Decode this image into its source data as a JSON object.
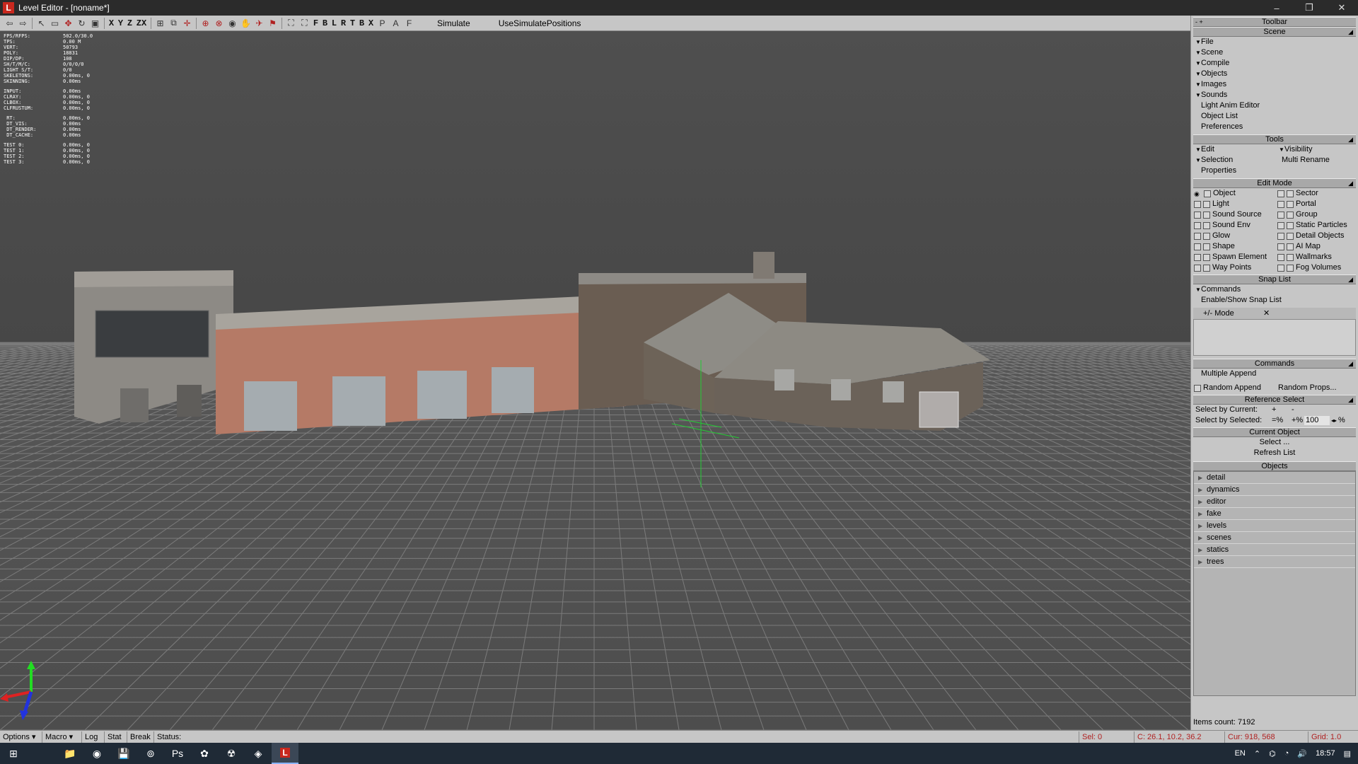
{
  "window": {
    "title": "Level Editor - [noname*]",
    "app_icon": "L",
    "min": "–",
    "max": "❐",
    "close": "✕"
  },
  "toolbar": {
    "axis_letters": [
      "X",
      "Y",
      "Z",
      "ZX"
    ],
    "letters": [
      "F",
      "B",
      "L",
      "R",
      "T",
      "B",
      "X"
    ],
    "simulate": "Simulate",
    "use_simulate_positions": "UseSimulatePositions"
  },
  "stats": [
    [
      "FPS/RFPS:",
      "502.0/30.0"
    ],
    [
      "TPS:",
      "0.00 M"
    ],
    [
      "VERT:",
      "50793"
    ],
    [
      "POLY:",
      "18831"
    ],
    [
      "DIP/DP:",
      "108"
    ],
    [
      "SH/T/M/C:",
      "0/0/0/0"
    ],
    [
      "LIGHT S/T:",
      "0/0"
    ],
    [
      "SKELETONS:",
      "0.00ms, 0"
    ],
    [
      "SKINNING:",
      "0.00ms"
    ],
    [
      "",
      ""
    ],
    [
      "INPUT:",
      "0.00ms"
    ],
    [
      "CLRAY:",
      "0.00ms, 0"
    ],
    [
      "CLBOX:",
      "0.00ms, 0"
    ],
    [
      "CLFRUSTUM:",
      "0.00ms, 0"
    ],
    [
      "",
      ""
    ],
    [
      " RT:",
      "0.00ms, 0"
    ],
    [
      " DT_VIS:",
      "0.00ms"
    ],
    [
      " DT_RENDER:",
      "0.00ms"
    ],
    [
      " DT_CACHE:",
      "0.00ms"
    ],
    [
      "",
      ""
    ],
    [
      "TEST 0:",
      "0.00ms, 0"
    ],
    [
      "TEST 1:",
      "0.00ms, 0"
    ],
    [
      "TEST 2:",
      "0.00ms, 0"
    ],
    [
      "TEST 3:",
      "0.00ms, 0"
    ]
  ],
  "panel": {
    "toolbar_header": "Toolbar",
    "toolbar_pin": "- +",
    "scene_header": "Scene",
    "scene_items": [
      {
        "label": "File",
        "arrow": true
      },
      {
        "label": "Scene",
        "arrow": true
      },
      {
        "label": "Compile",
        "arrow": true
      },
      {
        "label": "Objects",
        "arrow": true
      },
      {
        "label": "Images",
        "arrow": true
      },
      {
        "label": "Sounds",
        "arrow": true
      },
      {
        "label": "Light Anim Editor",
        "arrow": false
      },
      {
        "label": "Object List",
        "arrow": false
      },
      {
        "label": "Preferences",
        "arrow": false
      }
    ],
    "tools_header": "Tools",
    "tools": {
      "edit": "Edit",
      "visibility": "Visibility",
      "selection": "Selection",
      "multi_rename": "Multi Rename",
      "properties": "Properties"
    },
    "edit_mode_header": "Edit Mode",
    "edit_mode_left": [
      "Object",
      "Light",
      "Sound Source",
      "Sound Env",
      "Glow",
      "Shape",
      "Spawn Element",
      "Way Points"
    ],
    "edit_mode_right": [
      "Sector",
      "Portal",
      "Group",
      "Static Particles",
      "Detail Objects",
      "AI Map",
      "Wallmarks",
      "Fog Volumes"
    ],
    "snap_header": "Snap List",
    "snap_commands": "Commands",
    "snap_enable": "Enable/Show Snap List",
    "mode_label": "+/- Mode",
    "mode_close": "✕",
    "commands_header": "Commands",
    "multiple_append": "Multiple Append",
    "random_append": "Random Append",
    "random_props": "Random Props...",
    "ref_select_header": "Reference Select",
    "select_by_current": "Select by Current:",
    "select_by_current_plus": "+",
    "select_by_current_minus": "-",
    "select_by_selected": "Select by Selected:",
    "sel_eq_pct": "=%",
    "sel_plus_pct": "+%",
    "sel_value": "100",
    "sel_pct": "%",
    "current_object_header": "Current Object",
    "select_btn": "Select ...",
    "refresh_list": "Refresh List",
    "objects_header": "Objects",
    "objects": [
      "detail",
      "dynamics",
      "editor",
      "fake",
      "levels",
      "scenes",
      "statics",
      "trees"
    ],
    "items_count": "Items count: 7192"
  },
  "status": {
    "options": "Options",
    "macro": "Macro",
    "log": "Log",
    "stat": "Stat",
    "break": "Break",
    "status_label": "Status:",
    "sel": "Sel: 0",
    "coords": "C: 26.1, 10.2, 36.2",
    "cur": "Cur: 918, 568",
    "grid": "Grid: 1.0"
  },
  "taskbar": {
    "lang": "EN",
    "time": "18:57"
  }
}
